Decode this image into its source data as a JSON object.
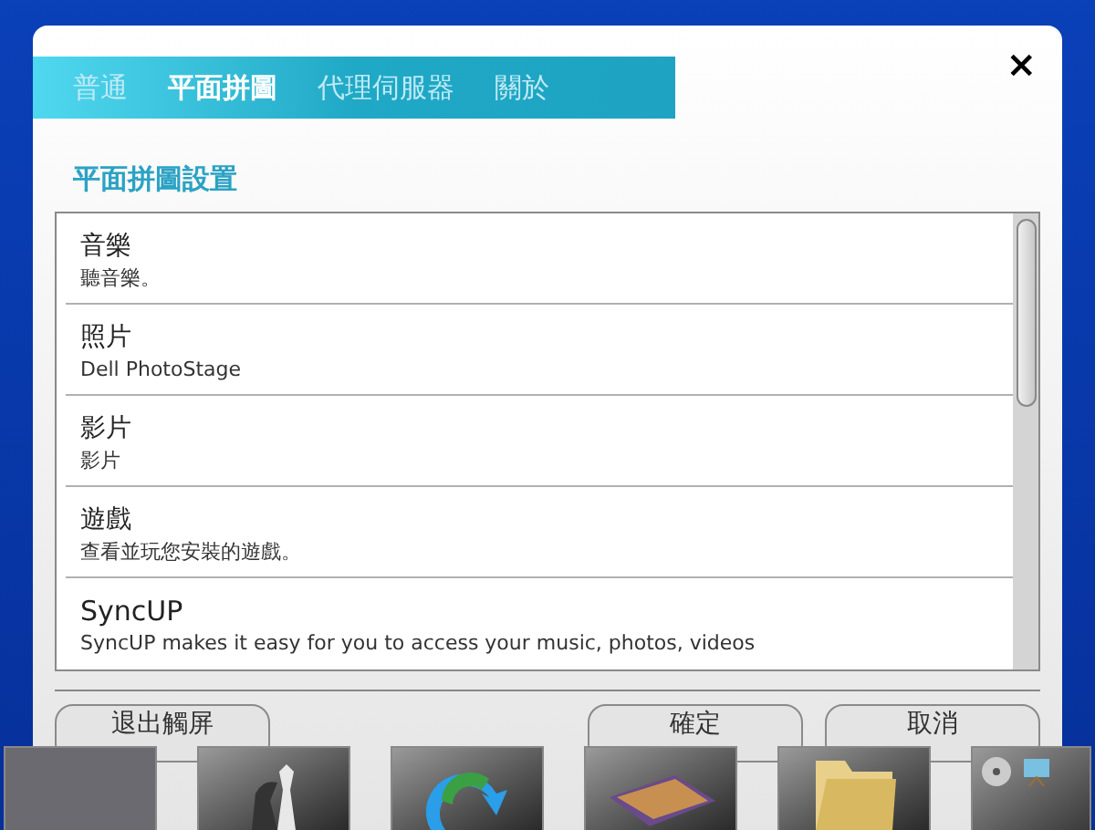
{
  "tabs": [
    {
      "label": "普通",
      "selected": false
    },
    {
      "label": "平面拼圖",
      "selected": true
    },
    {
      "label": "代理伺服器",
      "selected": false
    },
    {
      "label": "關於",
      "selected": false
    }
  ],
  "close": "×",
  "section_title": "平面拼圖設置",
  "items": [
    {
      "title": "音樂",
      "description": "聽音樂。"
    },
    {
      "title": "照片",
      "description": "Dell PhotoStage"
    },
    {
      "title": "影片",
      "description": "影片"
    },
    {
      "title": "遊戲",
      "description": "查看並玩您安裝的遊戲。"
    },
    {
      "title": "SyncUP",
      "description": "SyncUP makes it easy for you to access your music, photos, videos"
    }
  ],
  "buttons": {
    "exit": "退出觸屏",
    "ok": "確定",
    "cancel": "取消"
  },
  "dock": [
    {
      "kind": "photo"
    },
    {
      "kind": "chess"
    },
    {
      "kind": "sync"
    },
    {
      "kind": "books"
    },
    {
      "kind": "folder"
    },
    {
      "kind": "tray"
    }
  ]
}
